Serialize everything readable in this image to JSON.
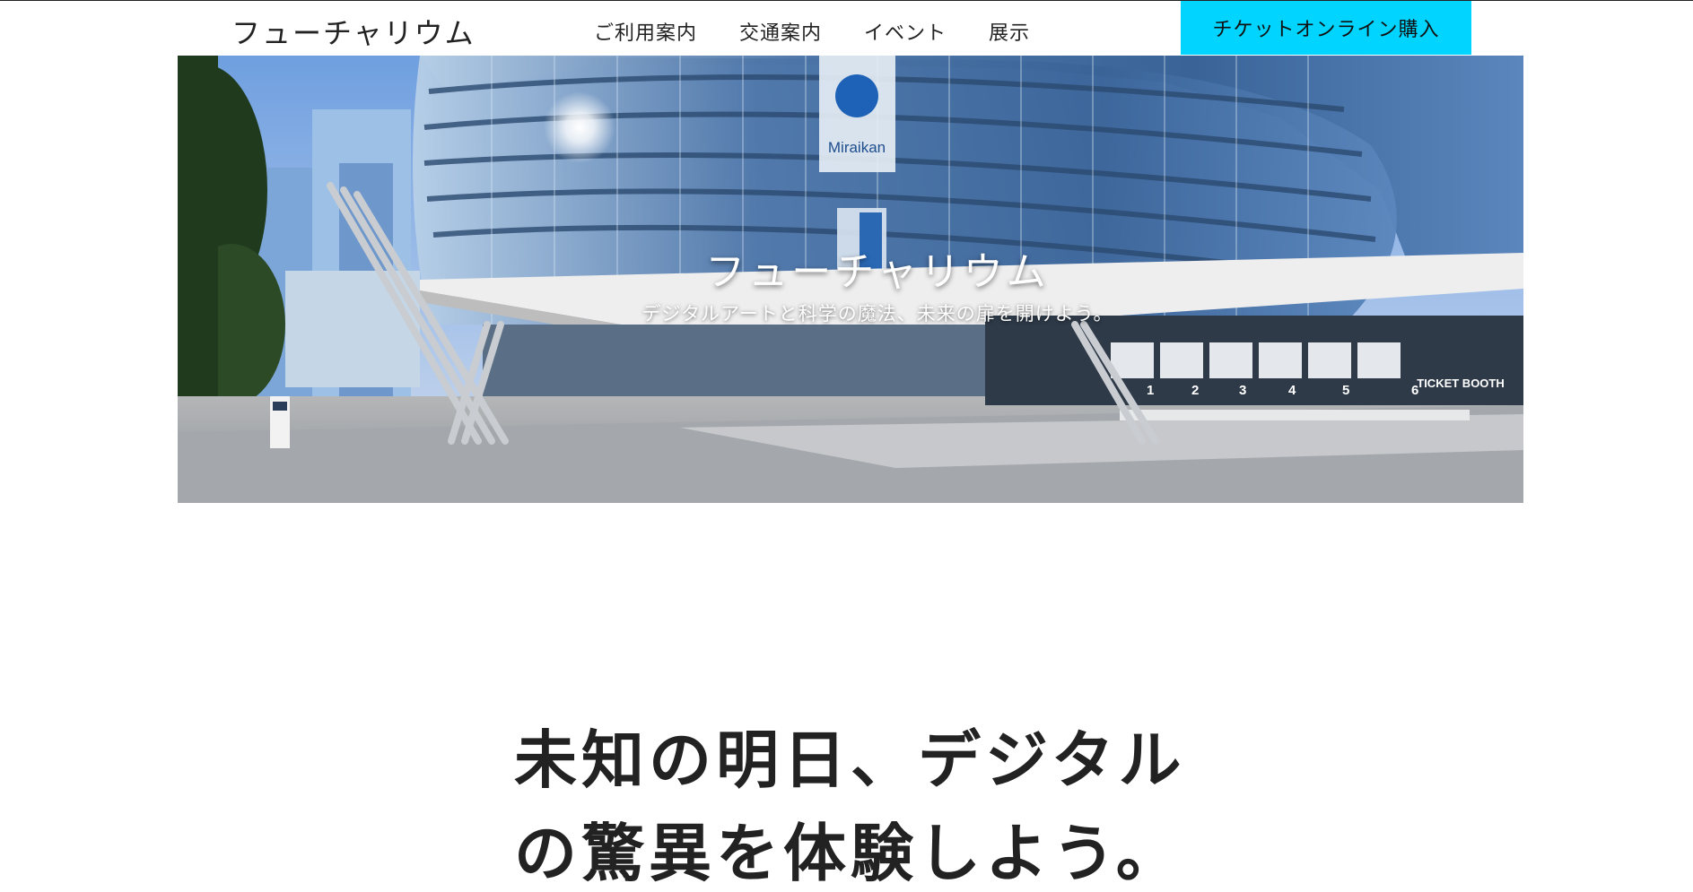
{
  "header": {
    "logo": "フューチャリウム",
    "nav": [
      {
        "label": "ご利用案内"
      },
      {
        "label": "交通案内"
      },
      {
        "label": "イベント"
      },
      {
        "label": "展示"
      }
    ],
    "cta_label": "チケットオンライン購入"
  },
  "hero": {
    "title": "フューチャリウム",
    "subtitle": "デジタルアートと科学の魔法、未来の扉を開けよう。",
    "sign_brand": "Miraikan",
    "ticket_booth": "TICKET BOOTH",
    "booth_numbers": [
      "1",
      "2",
      "3",
      "4",
      "5",
      "6"
    ]
  },
  "main": {
    "headline_line1": "未知の明日、デジタル",
    "headline_line2": "の驚異を体験しよう。"
  },
  "colors": {
    "accent": "#00d4ff",
    "text": "#222222",
    "background": "#ffffff"
  }
}
